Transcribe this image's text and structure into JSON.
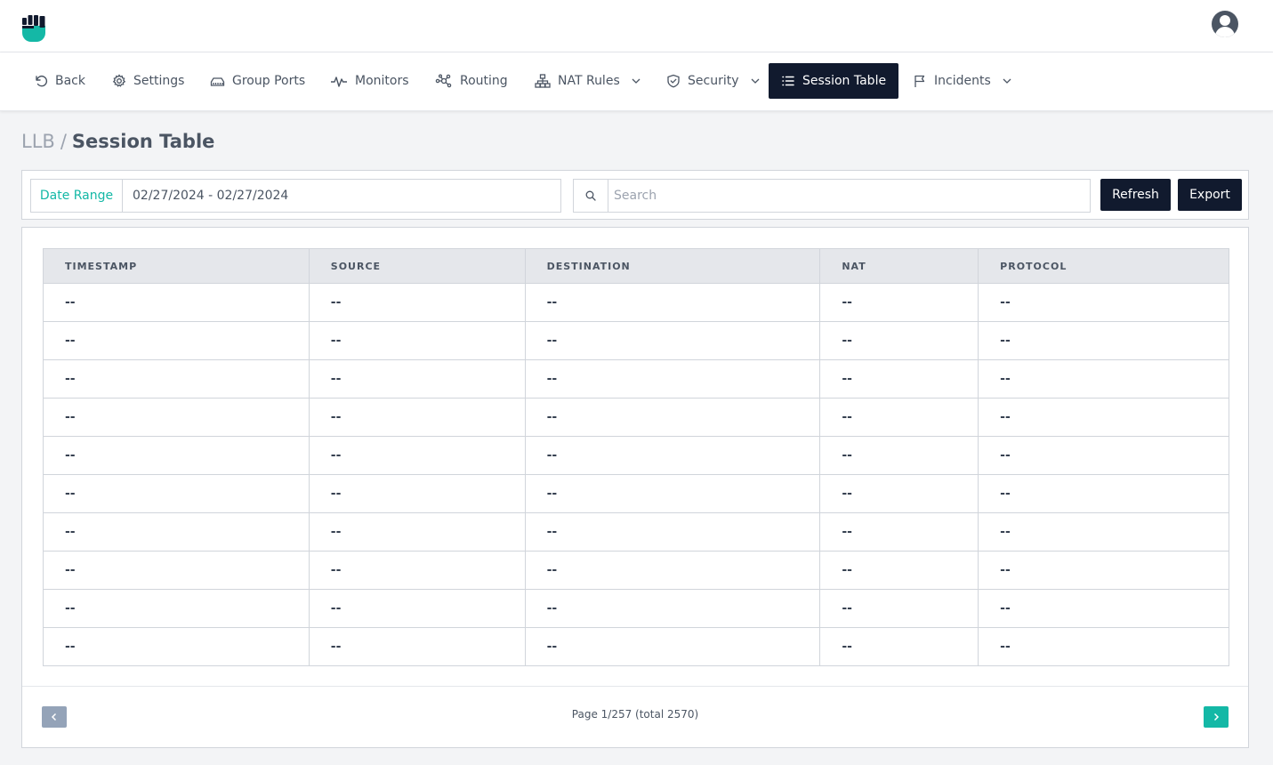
{
  "header": {
    "logo_icon": "fist-logo-icon",
    "avatar_icon": "user-avatar-icon"
  },
  "nav": {
    "items": [
      {
        "label": "Back",
        "icon": "undo-icon"
      },
      {
        "label": "Settings",
        "icon": "gear-icon"
      },
      {
        "label": "Group Ports",
        "icon": "ports-icon"
      },
      {
        "label": "Monitors",
        "icon": "pulse-icon"
      },
      {
        "label": "Routing",
        "icon": "network-icon"
      },
      {
        "label": "NAT Rules",
        "icon": "sitemap-icon",
        "dropdown": true
      },
      {
        "label": "Security",
        "icon": "shield-icon",
        "dropdown": true
      },
      {
        "label": "Session Table",
        "icon": "list-icon",
        "active": true
      },
      {
        "label": "Incidents",
        "icon": "flag-icon",
        "dropdown": true
      }
    ]
  },
  "breadcrumb": {
    "root": "LLB",
    "separator": "/",
    "current": "Session Table"
  },
  "filters": {
    "date_label": "Date Range",
    "date_value": "02/27/2024 - 02/27/2024",
    "search_placeholder": "Search",
    "search_value": "",
    "refresh_label": "Refresh",
    "export_label": "Export"
  },
  "table": {
    "columns": [
      "TIMESTAMP",
      "SOURCE",
      "DESTINATION",
      "NAT",
      "PROTOCOL"
    ],
    "rows": [
      [
        "--",
        "--",
        "--",
        "--",
        "--"
      ],
      [
        "--",
        "--",
        "--",
        "--",
        "--"
      ],
      [
        "--",
        "--",
        "--",
        "--",
        "--"
      ],
      [
        "--",
        "--",
        "--",
        "--",
        "--"
      ],
      [
        "--",
        "--",
        "--",
        "--",
        "--"
      ],
      [
        "--",
        "--",
        "--",
        "--",
        "--"
      ],
      [
        "--",
        "--",
        "--",
        "--",
        "--"
      ],
      [
        "--",
        "--",
        "--",
        "--",
        "--"
      ],
      [
        "--",
        "--",
        "--",
        "--",
        "--"
      ],
      [
        "--",
        "--",
        "--",
        "--",
        "--"
      ]
    ]
  },
  "pagination": {
    "text": "Page 1/257 (total 2570)",
    "page": 1,
    "pages": 257,
    "total": 2570
  },
  "colors": {
    "accent": "#14b8a6",
    "dark": "#111a2e"
  }
}
